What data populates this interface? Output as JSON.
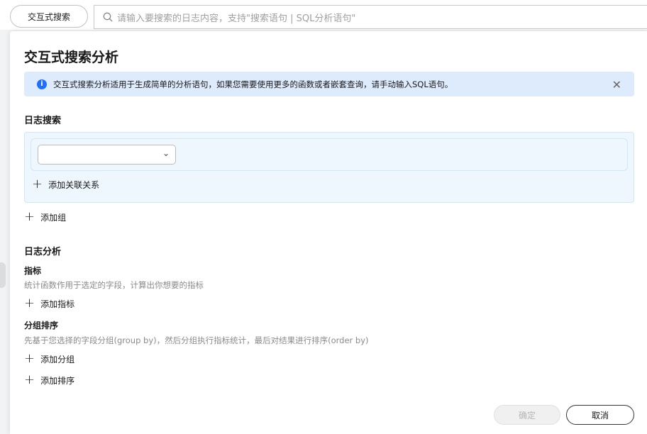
{
  "topbar": {
    "mode_button": "交互式搜索",
    "search_placeholder": "请输入要搜索的日志内容，支持\"搜索语句 | SQL分析语句\""
  },
  "modal": {
    "title": "交互式搜索分析",
    "alert": "交互式搜索分析适用于生成简单的分析语句，如果您需要使用更多的函数或者嵌套查询，请手动输入SQL语句。",
    "log_search": {
      "heading": "日志搜索",
      "select_value": "",
      "add_relation": "添加关联关系",
      "add_group": "添加组"
    },
    "log_analysis": {
      "heading": "日志分析",
      "metrics": {
        "title": "指标",
        "desc": "统计函数作用于选定的字段，计算出你想要的指标",
        "add": "添加指标"
      },
      "group_sort": {
        "title": "分组排序",
        "desc": "先基于您选择的字段分组(group by)，然后分组执行指标统计，最后对结果进行排序(order by)",
        "add_group": "添加分组",
        "add_sort": "添加排序"
      }
    },
    "buttons": {
      "ok": "确定",
      "cancel": "取消"
    }
  }
}
